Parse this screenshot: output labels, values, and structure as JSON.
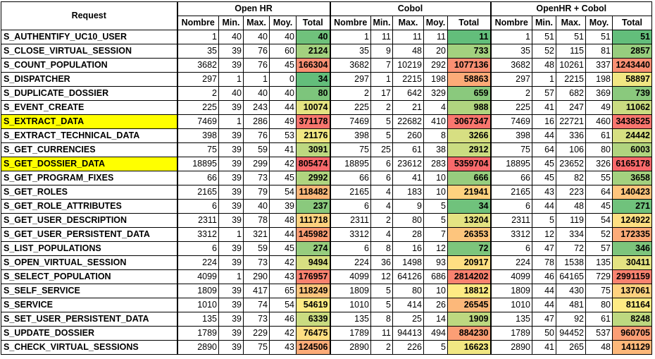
{
  "table": {
    "request_header": "Request",
    "groups": [
      "Open HR",
      "Cobol",
      "OpenHR + Cobol"
    ],
    "subheaders": [
      "Nombre",
      "Min.",
      "Max.",
      "Moy.",
      "Total"
    ],
    "highlight_color": "#ffff00",
    "rows": [
      {
        "name": "S_AUTHENTIFY_UC10_USER",
        "open_hr": [
          1,
          40,
          40,
          40,
          40
        ],
        "cobol": [
          1,
          11,
          11,
          11,
          11
        ],
        "combined": [
          1,
          51,
          51,
          51,
          51
        ]
      },
      {
        "name": "S_CLOSE_VIRTUAL_SESSION",
        "open_hr": [
          35,
          39,
          76,
          60,
          2124
        ],
        "cobol": [
          35,
          9,
          48,
          20,
          733
        ],
        "combined": [
          35,
          52,
          115,
          81,
          2857
        ]
      },
      {
        "name": "S_COUNT_POPULATION",
        "open_hr": [
          3682,
          39,
          76,
          45,
          166304
        ],
        "cobol": [
          3682,
          7,
          10219,
          292,
          1077136
        ],
        "combined": [
          3682,
          48,
          10261,
          337,
          1243440
        ]
      },
      {
        "name": "S_DISPATCHER",
        "open_hr": [
          297,
          1,
          1,
          0,
          34
        ],
        "cobol": [
          297,
          1,
          2215,
          198,
          58863
        ],
        "combined": [
          297,
          1,
          2215,
          198,
          58897
        ]
      },
      {
        "name": "S_DUPLICATE_DOSSIER",
        "open_hr": [
          2,
          40,
          40,
          40,
          80
        ],
        "cobol": [
          2,
          17,
          642,
          329,
          659
        ],
        "combined": [
          2,
          57,
          682,
          369,
          739
        ]
      },
      {
        "name": "S_EVENT_CREATE",
        "open_hr": [
          225,
          39,
          243,
          44,
          10074
        ],
        "cobol": [
          225,
          2,
          21,
          4,
          988
        ],
        "combined": [
          225,
          41,
          247,
          49,
          11062
        ]
      },
      {
        "name": "S_EXTRACT_DATA",
        "highlight": true,
        "open_hr": [
          7469,
          1,
          286,
          49,
          371178
        ],
        "cobol": [
          7469,
          5,
          22682,
          410,
          3067347
        ],
        "combined": [
          7469,
          16,
          22721,
          460,
          3438525
        ]
      },
      {
        "name": "S_EXTRACT_TECHNICAL_DATA",
        "open_hr": [
          398,
          39,
          76,
          53,
          21176
        ],
        "cobol": [
          398,
          5,
          260,
          8,
          3266
        ],
        "combined": [
          398,
          44,
          336,
          61,
          24442
        ]
      },
      {
        "name": "S_GET_CURRENCIES",
        "open_hr": [
          75,
          39,
          59,
          41,
          3091
        ],
        "cobol": [
          75,
          25,
          61,
          38,
          2912
        ],
        "combined": [
          75,
          64,
          106,
          80,
          6003
        ]
      },
      {
        "name": "S_GET_DOSSIER_DATA",
        "highlight": true,
        "open_hr": [
          18895,
          39,
          299,
          42,
          805474
        ],
        "cobol": [
          18895,
          6,
          23612,
          283,
          5359704
        ],
        "combined": [
          18895,
          45,
          23652,
          326,
          6165178
        ]
      },
      {
        "name": "S_GET_PROGRAM_FIXES",
        "open_hr": [
          66,
          39,
          73,
          45,
          2992
        ],
        "cobol": [
          66,
          6,
          41,
          10,
          666
        ],
        "combined": [
          66,
          45,
          82,
          55,
          3658
        ]
      },
      {
        "name": "S_GET_ROLES",
        "open_hr": [
          2165,
          39,
          79,
          54,
          118482
        ],
        "cobol": [
          2165,
          4,
          183,
          10,
          21941
        ],
        "combined": [
          2165,
          43,
          223,
          64,
          140423
        ]
      },
      {
        "name": "S_GET_ROLE_ATTRIBUTES",
        "open_hr": [
          6,
          39,
          40,
          39,
          237
        ],
        "cobol": [
          6,
          4,
          9,
          5,
          34
        ],
        "combined": [
          6,
          44,
          48,
          45,
          271
        ]
      },
      {
        "name": "S_GET_USER_DESCRIPTION",
        "open_hr": [
          2311,
          39,
          78,
          48,
          111718
        ],
        "cobol": [
          2311,
          2,
          80,
          5,
          13204
        ],
        "combined": [
          2311,
          5,
          119,
          54,
          124922
        ]
      },
      {
        "name": "S_GET_USER_PERSISTENT_DATA",
        "open_hr": [
          3312,
          1,
          321,
          44,
          145982
        ],
        "cobol": [
          3312,
          4,
          28,
          7,
          26353
        ],
        "combined": [
          3312,
          12,
          334,
          52,
          172335
        ]
      },
      {
        "name": "S_LIST_POPULATIONS",
        "open_hr": [
          6,
          39,
          59,
          45,
          274
        ],
        "cobol": [
          6,
          8,
          16,
          12,
          72
        ],
        "combined": [
          6,
          47,
          72,
          57,
          346
        ]
      },
      {
        "name": "S_OPEN_VIRTUAL_SESSION",
        "open_hr": [
          224,
          39,
          73,
          42,
          9494
        ],
        "cobol": [
          224,
          36,
          1498,
          93,
          20917
        ],
        "combined": [
          224,
          78,
          1538,
          135,
          30411
        ]
      },
      {
        "name": "S_SELECT_POPULATION",
        "open_hr": [
          4099,
          1,
          290,
          43,
          176957
        ],
        "cobol": [
          4099,
          12,
          64126,
          686,
          2814202
        ],
        "combined": [
          4099,
          46,
          64165,
          729,
          2991159
        ]
      },
      {
        "name": "S_SELF_SERVICE",
        "open_hr": [
          1809,
          39,
          417,
          65,
          118249
        ],
        "cobol": [
          1809,
          5,
          80,
          10,
          18812
        ],
        "combined": [
          1809,
          44,
          430,
          75,
          137061
        ]
      },
      {
        "name": "S_SERVICE",
        "open_hr": [
          1010,
          39,
          74,
          54,
          54619
        ],
        "cobol": [
          1010,
          5,
          414,
          26,
          26545
        ],
        "combined": [
          1010,
          44,
          481,
          80,
          81164
        ]
      },
      {
        "name": "S_SET_USER_PERSISTENT_DATA",
        "open_hr": [
          135,
          39,
          73,
          46,
          6339
        ],
        "cobol": [
          135,
          8,
          25,
          14,
          1909
        ],
        "combined": [
          135,
          47,
          92,
          61,
          8248
        ]
      },
      {
        "name": "S_UPDATE_DOSSIER",
        "open_hr": [
          1789,
          39,
          229,
          42,
          76475
        ],
        "cobol": [
          1789,
          11,
          94413,
          494,
          884230
        ],
        "combined": [
          1789,
          50,
          94452,
          537,
          960705
        ]
      },
      {
        "name": "S_CHECK_VIRTUAL_SESSIONS",
        "open_hr": [
          2890,
          39,
          75,
          43,
          124506
        ],
        "cobol": [
          2890,
          2,
          226,
          5,
          16623
        ],
        "combined": [
          2890,
          41,
          265,
          48,
          141129
        ]
      }
    ]
  }
}
